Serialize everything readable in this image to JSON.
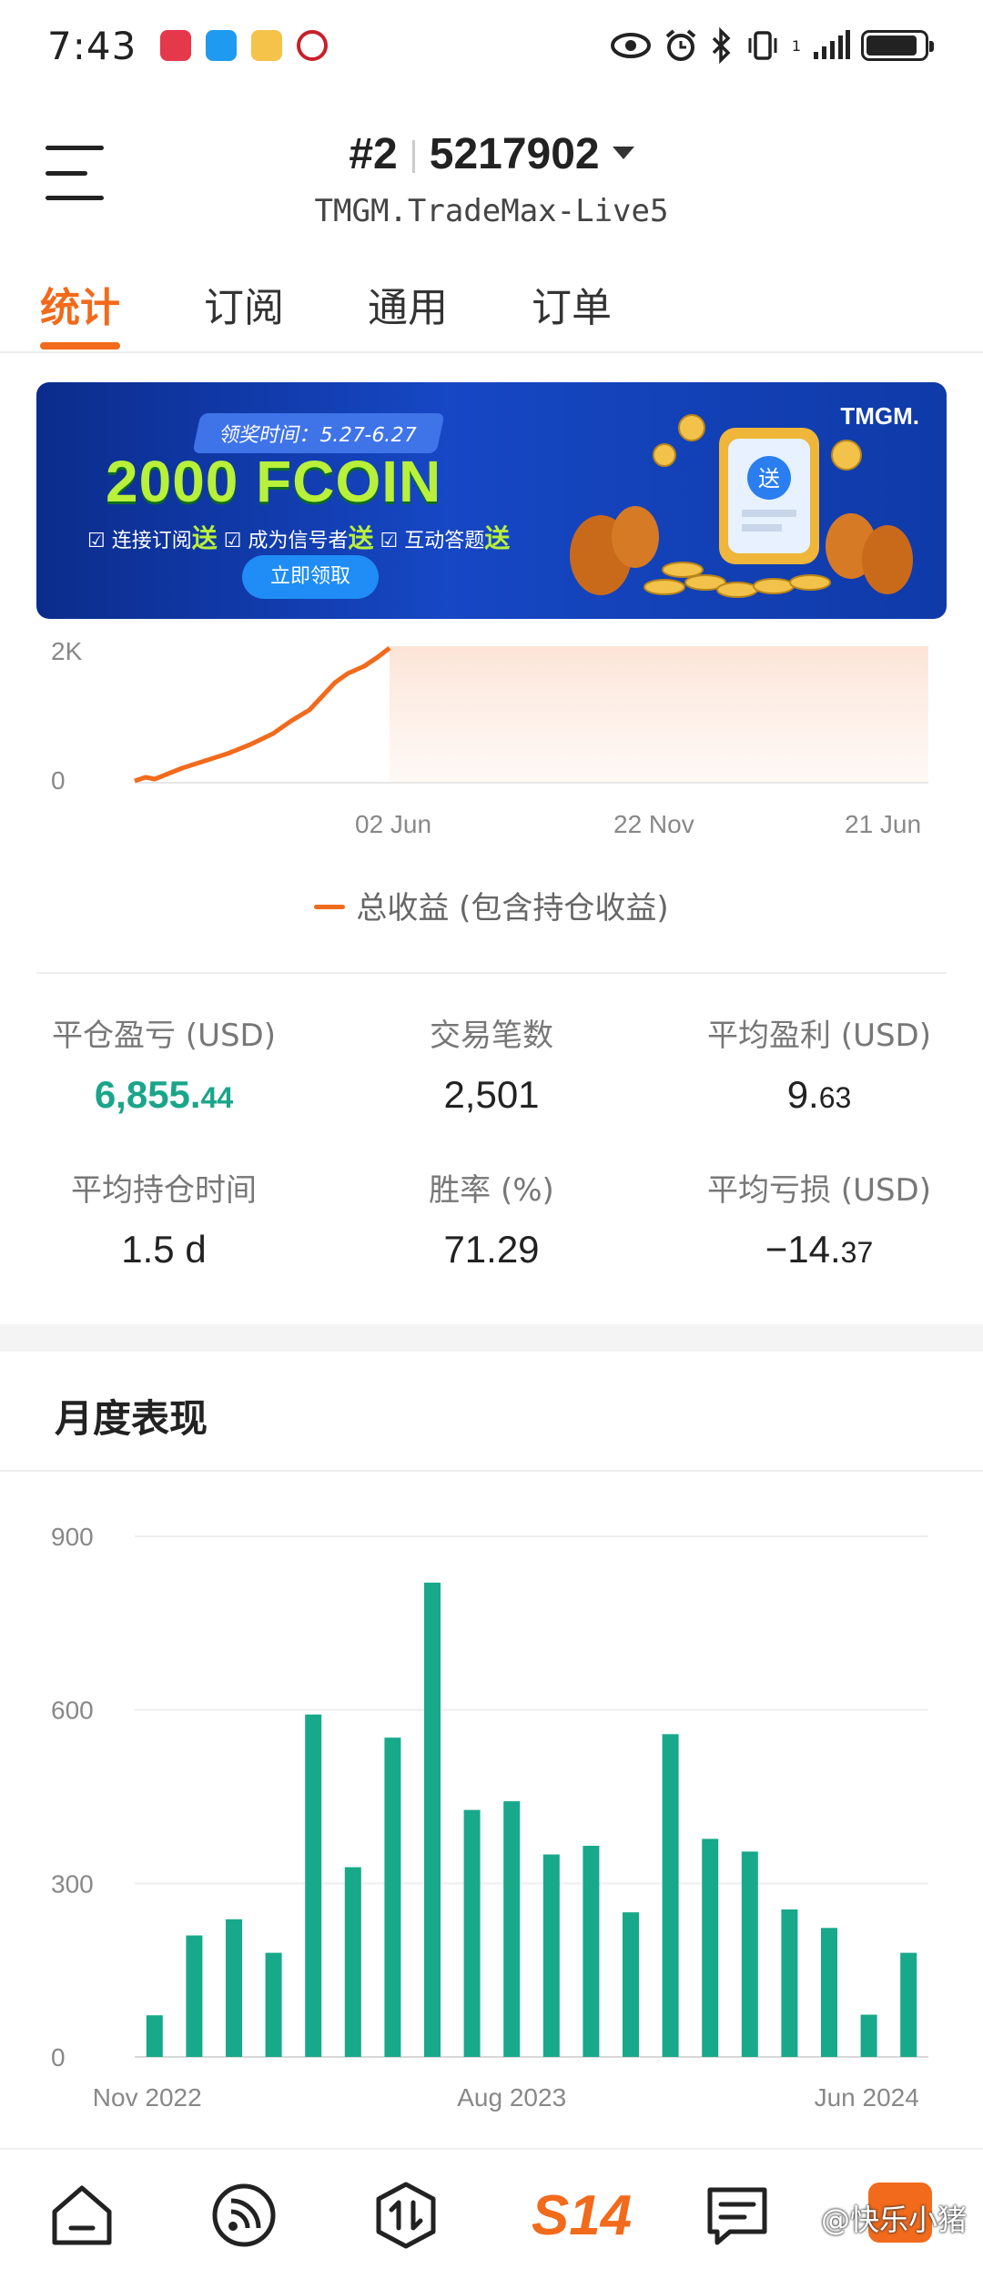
{
  "status_bar": {
    "time": "7:43",
    "signal_text": "1"
  },
  "header": {
    "rank": "#2",
    "account_number": "5217902",
    "server": "TMGM.TradeMax-Live5"
  },
  "tabs": [
    {
      "label": "统计",
      "active": true
    },
    {
      "label": "订阅",
      "active": false
    },
    {
      "label": "通用",
      "active": false
    },
    {
      "label": "订单",
      "active": false
    }
  ],
  "banner": {
    "date_text": "领奖时间：5.27-6.27",
    "title": "2000 FCOIN",
    "sub_items": [
      {
        "text": "连接订阅",
        "bold": "送"
      },
      {
        "text": "成为信号者",
        "bold": "送"
      },
      {
        "text": "互动答题",
        "bold": "送"
      }
    ],
    "button_label": "立即领取",
    "logo_text": "TMGM.",
    "badge_text": "送"
  },
  "equity_chart": {
    "y_ticks": [
      "2K",
      "0"
    ],
    "x_ticks": [
      "02 Jun",
      "22 Nov",
      "21 Jun"
    ],
    "legend": "总收益 (包含持仓收益)",
    "line_color": "#f26a1b"
  },
  "stats": [
    {
      "label": "平仓盈亏 (USD)",
      "value_int": "6,855.",
      "value_dec": "44",
      "color": "green"
    },
    {
      "label": "交易笔数",
      "value_int": "2,501",
      "value_dec": ""
    },
    {
      "label": "平均盈利 (USD)",
      "value_int": "9.",
      "value_dec": "63"
    },
    {
      "label": "平均持仓时间",
      "value_int": "1.5 d",
      "value_dec": ""
    },
    {
      "label": "胜率 (%)",
      "value_int": "71.29",
      "value_dec": ""
    },
    {
      "label": "平均亏损 (USD)",
      "value_int": "−14.",
      "value_dec": "37"
    }
  ],
  "monthly": {
    "title": "月度表现"
  },
  "chart_data": {
    "type": "bar",
    "title": "",
    "x_tick_labels": [
      "Nov 2022",
      "Aug 2023",
      "Jun 2024"
    ],
    "y_ticks": [
      900,
      600,
      300,
      0
    ],
    "ylim": [
      0,
      900
    ],
    "values": [
      72,
      210,
      238,
      180,
      592,
      328,
      552,
      820,
      427,
      442,
      350,
      365,
      250,
      558,
      377,
      355,
      255,
      223,
      73,
      180
    ],
    "bar_color": "#17a98a"
  },
  "bottom_nav": {
    "brand": "S14",
    "watermark": "@快乐小猪"
  }
}
